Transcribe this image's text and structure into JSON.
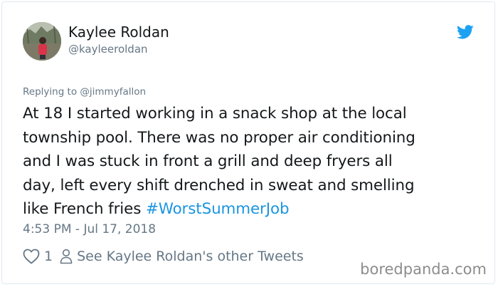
{
  "user": {
    "name": "Kaylee Roldan",
    "handle": "@kayleeroldan"
  },
  "reply": {
    "prefix": "Replying to ",
    "mention": "@jimmyfallon"
  },
  "tweet": {
    "lines": [
      "At 18 I started working in a snack shop at the local",
      "township pool. There was no proper air conditioning",
      "and I was stuck in front a grill and deep fryers all",
      "day, left every shift drenched in sweat and smelling",
      "like French fries "
    ],
    "hashtag": "#WorstSummerJob"
  },
  "timestamp": "4:53 PM - Jul 17, 2018",
  "actions": {
    "like_count": "1",
    "other_tweets_label": "See Kaylee Roldan's other Tweets"
  },
  "watermark": "boredpanda.com",
  "icons": {
    "brand": "twitter-bird-icon",
    "like": "heart-icon",
    "profile": "person-icon"
  },
  "colors": {
    "twitter_blue": "#1da1f2",
    "hashtag": "#1b95e0",
    "secondary_text": "#657786",
    "primary_text": "#14171a"
  }
}
